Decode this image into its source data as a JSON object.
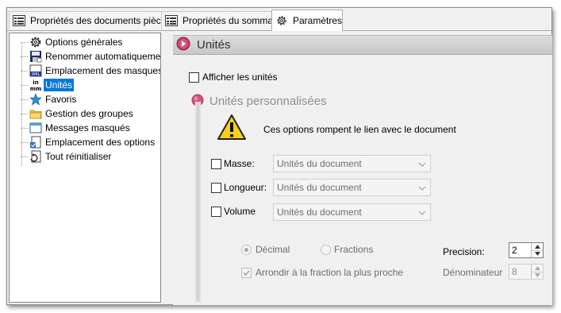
{
  "tabs": [
    {
      "label": "Propriétés des documents pièces",
      "icon": "properties-sheet-icon"
    },
    {
      "label": "Propriétés du sommaire",
      "icon": "properties-sheet-icon"
    },
    {
      "label": "Paramètres",
      "icon": "gear-icon"
    }
  ],
  "active_tab": "Paramètres",
  "tree": {
    "items": [
      {
        "label": "Options générales",
        "icon": "gear-icon"
      },
      {
        "label": "Renommer automatiquement le",
        "icon": "rename-save-icon"
      },
      {
        "label": "Emplacement des masques Sma",
        "icon": "xml-template-icon"
      },
      {
        "label": "Unités",
        "icon": "units-icon",
        "selected": true
      },
      {
        "label": "Favoris",
        "icon": "star-icon"
      },
      {
        "label": "Gestion des groupes",
        "icon": "folder-icon"
      },
      {
        "label": "Messages masqués",
        "icon": "window-icon"
      },
      {
        "label": "Emplacement des options",
        "icon": "options-file-icon"
      },
      {
        "label": "Tout réinitialiser",
        "icon": "reset-icon"
      }
    ]
  },
  "panel": {
    "title": "Unités",
    "show_units_label": "Afficher les unités",
    "show_units_checked": false,
    "custom_section_title": "Unités personnalisées",
    "warning_text": "Ces options rompent le lien avec le document",
    "rows": [
      {
        "label": "Masse:",
        "value": "Unités du document",
        "checked": false
      },
      {
        "label": "Longueur:",
        "value": "Unités du document",
        "checked": false
      },
      {
        "label": "Volume",
        "value": "Unités du document",
        "checked": false
      }
    ],
    "format": {
      "decimal_label": "Décimal",
      "fractions_label": "Fractions",
      "selected": "Décimal",
      "round_label": "Arrondir à la fraction la plus proche",
      "round_checked": true
    },
    "precision": {
      "label": "Precision:",
      "value": "2"
    },
    "denominator": {
      "label": "Dénominateur",
      "value": "8"
    }
  },
  "colors": {
    "selection": "#0078d7",
    "section_marker": "#d4537a",
    "disabled_text": "#6d6d6d"
  }
}
